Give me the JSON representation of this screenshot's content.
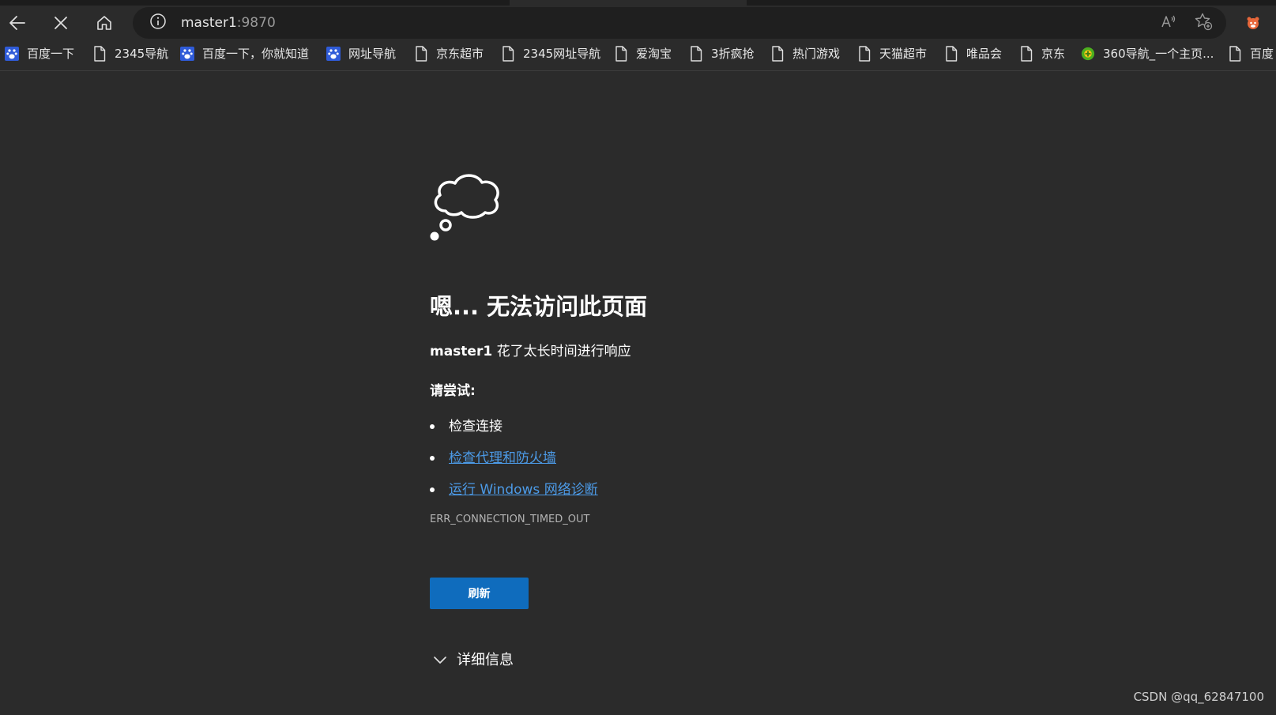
{
  "browser": {
    "url_host": "master1",
    "url_port": ":9870",
    "icons": {
      "back": "back-arrow-icon",
      "stop": "stop-x-icon",
      "home": "home-icon",
      "info": "info-icon",
      "read_aloud": "read-aloud-icon",
      "favorite": "add-favorite-icon",
      "extension": "extension-icon"
    }
  },
  "bookmarks": [
    {
      "label": "百度一下",
      "icon": "baidu-paw-icon"
    },
    {
      "label": "2345导航",
      "icon": "page-icon"
    },
    {
      "label": "百度一下，你就知道",
      "icon": "baidu-paw-icon"
    },
    {
      "label": "网址导航",
      "icon": "baidu-paw-icon"
    },
    {
      "label": "京东超市",
      "icon": "page-icon"
    },
    {
      "label": "2345网址导航",
      "icon": "page-icon"
    },
    {
      "label": "爱淘宝",
      "icon": "page-icon"
    },
    {
      "label": "3折疯抢",
      "icon": "page-icon"
    },
    {
      "label": "热门游戏",
      "icon": "page-icon"
    },
    {
      "label": "天猫超市",
      "icon": "page-icon"
    },
    {
      "label": "唯品会",
      "icon": "page-icon"
    },
    {
      "label": "京东",
      "icon": "page-icon"
    },
    {
      "label": "360导航_一个主页...",
      "icon": "360-icon"
    },
    {
      "label": "百度",
      "icon": "page-icon"
    }
  ],
  "error_page": {
    "title": "嗯... 无法访问此页面",
    "host": "master1",
    "message": " 花了太长时间进行响应",
    "try_heading": "请尝试:",
    "suggestions": [
      {
        "text": "检查连接",
        "is_link": false
      },
      {
        "text": "检查代理和防火墙",
        "is_link": true
      },
      {
        "text": "运行 Windows 网络诊断",
        "is_link": true
      }
    ],
    "error_code": "ERR_CONNECTION_TIMED_OUT",
    "refresh_label": "刷新",
    "details_label": "详细信息",
    "link_color": "#4c9be8",
    "button_color": "#0f6cbd"
  },
  "watermark": "CSDN @qq_62847100"
}
